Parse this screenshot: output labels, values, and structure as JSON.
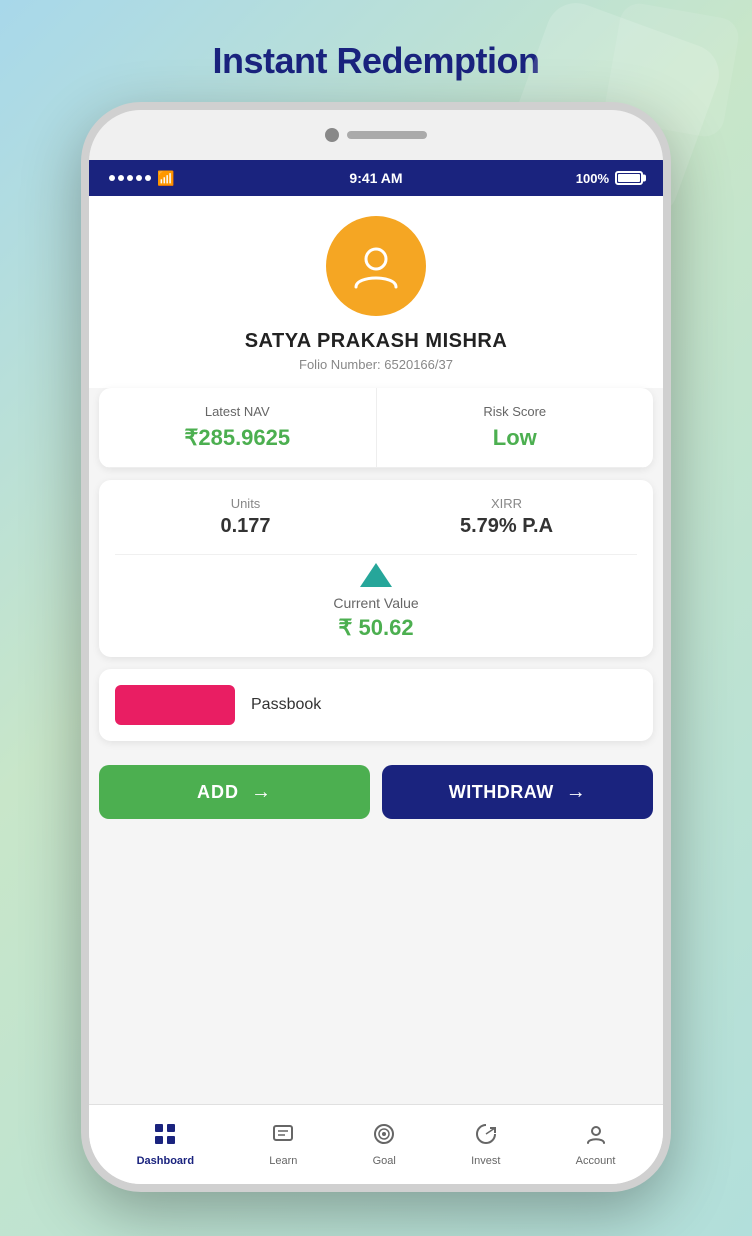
{
  "page": {
    "title": "Instant Redemption",
    "background_color": "#a8d8ea"
  },
  "status_bar": {
    "time": "9:41 AM",
    "battery": "100%"
  },
  "profile": {
    "name": "SATYA PRAKASH MISHRA",
    "folio_label": "Folio Number:",
    "folio_number": "6520166/37"
  },
  "stats": {
    "nav_label": "Latest NAV",
    "nav_value": "₹285.9625",
    "risk_label": "Risk Score",
    "risk_value": "Low"
  },
  "portfolio": {
    "units_label": "Units",
    "units_value": "0.177",
    "xirr_label": "XIRR",
    "xirr_value": "5.79% P.A",
    "current_value_label": "Current Value",
    "current_value": "₹ 50.62"
  },
  "passbook": {
    "label": "Passbook"
  },
  "buttons": {
    "add_label": "ADD",
    "withdraw_label": "WITHDRAW"
  },
  "nav_tabs": [
    {
      "id": "dashboard",
      "label": "Dashboard",
      "active": true
    },
    {
      "id": "learn",
      "label": "Learn",
      "active": false
    },
    {
      "id": "goal",
      "label": "Goal",
      "active": false
    },
    {
      "id": "invest",
      "label": "Invest",
      "active": false
    },
    {
      "id": "account",
      "label": "Account",
      "active": false
    }
  ]
}
